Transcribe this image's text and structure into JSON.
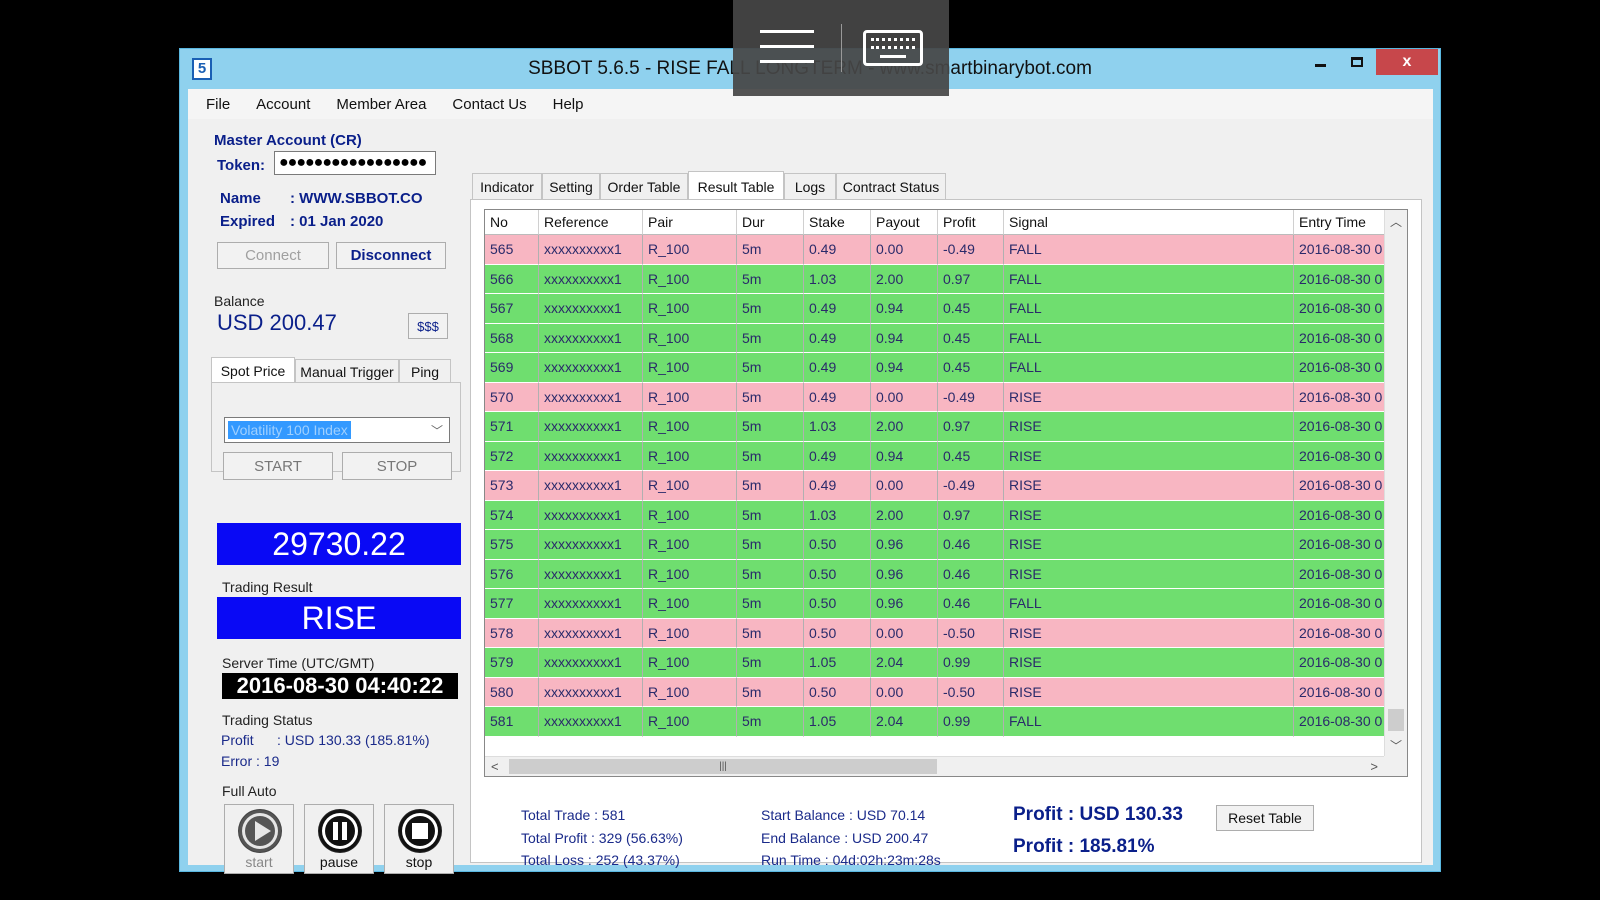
{
  "window": {
    "icon": "5",
    "title": "SBBOT 5.6.5 - RISE FALL LONGTERM - www.smartbinarybot.com",
    "close": "x"
  },
  "menu": [
    "File",
    "Account",
    "Member Area",
    "Contact Us",
    "Help"
  ],
  "account": {
    "heading": "Master Account (CR)",
    "token_label": "Token:",
    "token_value": "●●●●●●●●●●●●●●●●●",
    "name_label": "Name",
    "name_value": ": WWW.SBBOT.CO",
    "expired_label": "Expired",
    "expired_value": ": 01 Jan 2020",
    "connect": "Connect",
    "disconnect": "Disconnect"
  },
  "balance": {
    "label": "Balance",
    "value": "USD 200.47",
    "btn": "$$$"
  },
  "spot": {
    "tabs": [
      "Spot Price",
      "Manual Trigger",
      "Ping"
    ],
    "selected": "Volatility 100 Index",
    "start": "START",
    "stop": "STOP",
    "price": "29730.22"
  },
  "trading_result": {
    "label": "Trading Result",
    "value": "RISE"
  },
  "server_time": {
    "label": "Server Time (UTC/GMT)",
    "value": "2016-08-30 04:40:22"
  },
  "trading_status": {
    "label": "Trading Status",
    "profit": "Profit      : USD 130.33 (185.81%)",
    "error": "Error : 19"
  },
  "full_auto": {
    "label": "Full Auto",
    "start": "start",
    "pause": "pause",
    "stop": "stop"
  },
  "tabs": [
    "Indicator",
    "Setting",
    "Order Table",
    "Result Table",
    "Logs",
    "Contract Status"
  ],
  "table": {
    "columns": [
      "No",
      "Reference",
      "Pair",
      "Dur",
      "Stake",
      "Payout",
      "Profit",
      "Signal",
      "Entry Time"
    ],
    "rows": [
      {
        "no": "565",
        "ref": "xxxxxxxxxx1",
        "pair": "R_100",
        "dur": "5m",
        "stake": "0.49",
        "payout": "0.00",
        "profit": "-0.49",
        "signal": "FALL",
        "time": "2016-08-30 0",
        "result": "loss"
      },
      {
        "no": "566",
        "ref": "xxxxxxxxxx1",
        "pair": "R_100",
        "dur": "5m",
        "stake": "1.03",
        "payout": "2.00",
        "profit": "0.97",
        "signal": "FALL",
        "time": "2016-08-30 0",
        "result": "win"
      },
      {
        "no": "567",
        "ref": "xxxxxxxxxx1",
        "pair": "R_100",
        "dur": "5m",
        "stake": "0.49",
        "payout": "0.94",
        "profit": "0.45",
        "signal": "FALL",
        "time": "2016-08-30 0",
        "result": "win"
      },
      {
        "no": "568",
        "ref": "xxxxxxxxxx1",
        "pair": "R_100",
        "dur": "5m",
        "stake": "0.49",
        "payout": "0.94",
        "profit": "0.45",
        "signal": "FALL",
        "time": "2016-08-30 0",
        "result": "win"
      },
      {
        "no": "569",
        "ref": "xxxxxxxxxx1",
        "pair": "R_100",
        "dur": "5m",
        "stake": "0.49",
        "payout": "0.94",
        "profit": "0.45",
        "signal": "FALL",
        "time": "2016-08-30 0",
        "result": "win"
      },
      {
        "no": "570",
        "ref": "xxxxxxxxxx1",
        "pair": "R_100",
        "dur": "5m",
        "stake": "0.49",
        "payout": "0.00",
        "profit": "-0.49",
        "signal": "RISE",
        "time": "2016-08-30 0",
        "result": "loss"
      },
      {
        "no": "571",
        "ref": "xxxxxxxxxx1",
        "pair": "R_100",
        "dur": "5m",
        "stake": "1.03",
        "payout": "2.00",
        "profit": "0.97",
        "signal": "RISE",
        "time": "2016-08-30 0",
        "result": "win"
      },
      {
        "no": "572",
        "ref": "xxxxxxxxxx1",
        "pair": "R_100",
        "dur": "5m",
        "stake": "0.49",
        "payout": "0.94",
        "profit": "0.45",
        "signal": "RISE",
        "time": "2016-08-30 0",
        "result": "win"
      },
      {
        "no": "573",
        "ref": "xxxxxxxxxx1",
        "pair": "R_100",
        "dur": "5m",
        "stake": "0.49",
        "payout": "0.00",
        "profit": "-0.49",
        "signal": "RISE",
        "time": "2016-08-30 0",
        "result": "loss"
      },
      {
        "no": "574",
        "ref": "xxxxxxxxxx1",
        "pair": "R_100",
        "dur": "5m",
        "stake": "1.03",
        "payout": "2.00",
        "profit": "0.97",
        "signal": "RISE",
        "time": "2016-08-30 0",
        "result": "win"
      },
      {
        "no": "575",
        "ref": "xxxxxxxxxx1",
        "pair": "R_100",
        "dur": "5m",
        "stake": "0.50",
        "payout": "0.96",
        "profit": "0.46",
        "signal": "RISE",
        "time": "2016-08-30 0",
        "result": "win"
      },
      {
        "no": "576",
        "ref": "xxxxxxxxxx1",
        "pair": "R_100",
        "dur": "5m",
        "stake": "0.50",
        "payout": "0.96",
        "profit": "0.46",
        "signal": "RISE",
        "time": "2016-08-30 0",
        "result": "win"
      },
      {
        "no": "577",
        "ref": "xxxxxxxxxx1",
        "pair": "R_100",
        "dur": "5m",
        "stake": "0.50",
        "payout": "0.96",
        "profit": "0.46",
        "signal": "FALL",
        "time": "2016-08-30 0",
        "result": "win"
      },
      {
        "no": "578",
        "ref": "xxxxxxxxxx1",
        "pair": "R_100",
        "dur": "5m",
        "stake": "0.50",
        "payout": "0.00",
        "profit": "-0.50",
        "signal": "RISE",
        "time": "2016-08-30 0",
        "result": "loss"
      },
      {
        "no": "579",
        "ref": "xxxxxxxxxx1",
        "pair": "R_100",
        "dur": "5m",
        "stake": "1.05",
        "payout": "2.04",
        "profit": "0.99",
        "signal": "RISE",
        "time": "2016-08-30 0",
        "result": "win"
      },
      {
        "no": "580",
        "ref": "xxxxxxxxxx1",
        "pair": "R_100",
        "dur": "5m",
        "stake": "0.50",
        "payout": "0.00",
        "profit": "-0.50",
        "signal": "RISE",
        "time": "2016-08-30 0",
        "result": "loss"
      },
      {
        "no": "581",
        "ref": "xxxxxxxxxx1",
        "pair": "R_100",
        "dur": "5m",
        "stake": "1.05",
        "payout": "2.04",
        "profit": "0.99",
        "signal": "FALL",
        "time": "2016-08-30 0",
        "result": "win"
      }
    ]
  },
  "summary": {
    "total_trade": "Total Trade : 581",
    "total_profit": "Total Profit : 329 (56.63%)",
    "total_loss": "Total Loss : 252 (43.37%)",
    "start_balance": "Start Balance : USD 70.14",
    "end_balance": "End Balance : USD 200.47",
    "run_time": "Run Time : 04d:02h:23m:28s",
    "profit_usd": "Profit : USD 130.33",
    "profit_pct": "Profit : 185.81%",
    "reset": "Reset Table"
  },
  "colors": {
    "win_row": "#6fde6f",
    "loss_row": "#f8b6c2",
    "accent_blue": "#0909f5",
    "title_bar": "#8fd1ee"
  }
}
